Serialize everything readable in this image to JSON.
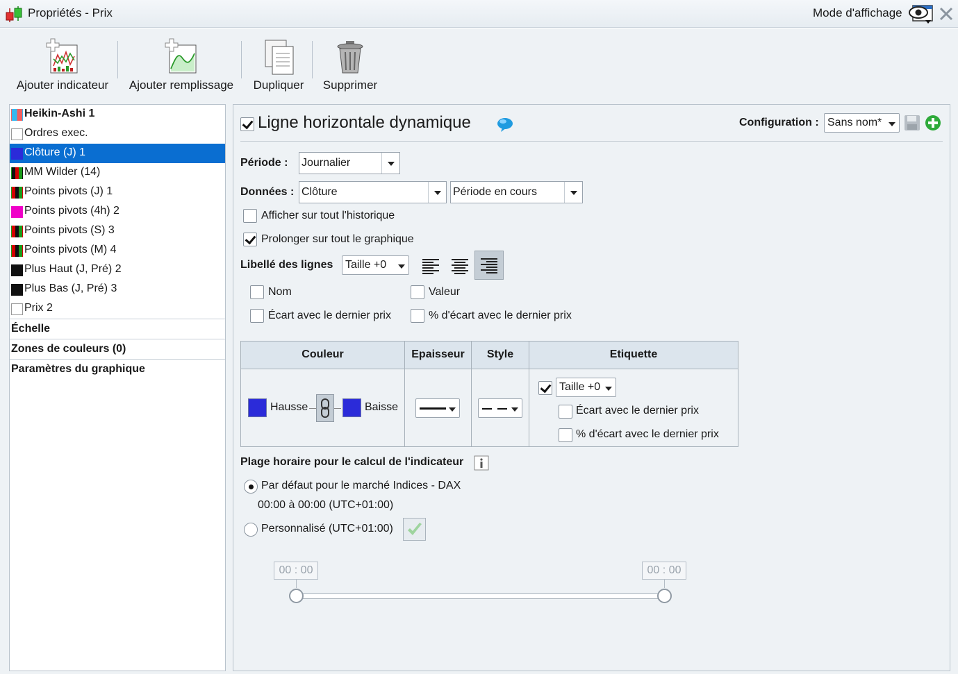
{
  "window": {
    "title": "Propriétés - Prix",
    "mode_label": "Mode d'affichage"
  },
  "toolbar": {
    "add_indicator": "Ajouter indicateur",
    "add_fill": "Ajouter remplissage",
    "duplicate": "Dupliquer",
    "delete": "Supprimer"
  },
  "sidebar": {
    "items": [
      {
        "label": "Heikin-Ashi 1",
        "bold": true,
        "swatch": [
          "#35b9f0",
          "#f06060"
        ]
      },
      {
        "label": "Ordres exec.",
        "swatch": [
          "#ffffff"
        ]
      },
      {
        "label": "Clôture (J) 1",
        "selected": true,
        "swatch": [
          "#2b2bd9"
        ]
      },
      {
        "label": "MM Wilder (14)",
        "swatch": [
          "#111111",
          "#d40000",
          "#1a9a1a"
        ]
      },
      {
        "label": "Points pivots (J) 1",
        "swatch": [
          "#d40000",
          "#111111",
          "#1a9a1a"
        ]
      },
      {
        "label": "Points pivots (4h) 2",
        "swatch": [
          "#f000c8"
        ]
      },
      {
        "label": "Points pivots (S) 3",
        "swatch": [
          "#d40000",
          "#111111",
          "#1a9a1a"
        ]
      },
      {
        "label": "Points pivots (M) 4",
        "swatch": [
          "#d40000",
          "#111111",
          "#1a9a1a"
        ]
      },
      {
        "label": "Plus Haut (J, Pré) 2",
        "swatch": [
          "#111111"
        ]
      },
      {
        "label": "Plus Bas (J, Pré) 3",
        "swatch": [
          "#111111"
        ]
      },
      {
        "label": "Prix 2",
        "swatch": [
          "#ffffff"
        ]
      }
    ],
    "sections": [
      "Échelle",
      "Zones de couleurs (0)",
      "Paramètres du graphique"
    ]
  },
  "panel": {
    "title": "Ligne horizontale dynamique",
    "title_checked": true,
    "config_label": "Configuration :",
    "config_value": "Sans nom*",
    "period_label": "Période :",
    "period_value": "Journalier",
    "data_label": "Données :",
    "data_value": "Clôture",
    "data_period_value": "Période en cours",
    "show_history": {
      "label": "Afficher sur tout l'historique",
      "checked": false
    },
    "extend_chart": {
      "label": "Prolonger sur tout le graphique",
      "checked": true
    },
    "labels_label": "Libellé des lignes",
    "labels_size": "Taille +0",
    "name": {
      "label": "Nom",
      "checked": false
    },
    "value": {
      "label": "Valeur",
      "checked": false
    },
    "gap_last": {
      "label": "Écart avec le dernier prix",
      "checked": false
    },
    "pct_gap_last": {
      "label": "% d'écart avec le dernier prix",
      "checked": false
    }
  },
  "table": {
    "headers": [
      "Couleur",
      "Epaisseur",
      "Style",
      "Etiquette"
    ],
    "up_label": "Hausse",
    "down_label": "Baisse",
    "up_color": "#2b2bd9",
    "down_color": "#2b2bd9",
    "tag_checked": true,
    "tag_size": "Taille +0",
    "tag_gap_last": "Écart avec le dernier prix",
    "tag_pct_gap_last": "% d'écart avec le dernier prix"
  },
  "schedule": {
    "title": "Plage horaire pour le calcul de l'indicateur",
    "default_label": "Par défaut pour le marché Indices - DAX",
    "default_range": "00:00 à 00:00 (UTC+01:00)",
    "custom_label": "Personnalisé (UTC+01:00)",
    "start_time": "00 : 00",
    "end_time": "00 : 00",
    "selected": "default"
  }
}
